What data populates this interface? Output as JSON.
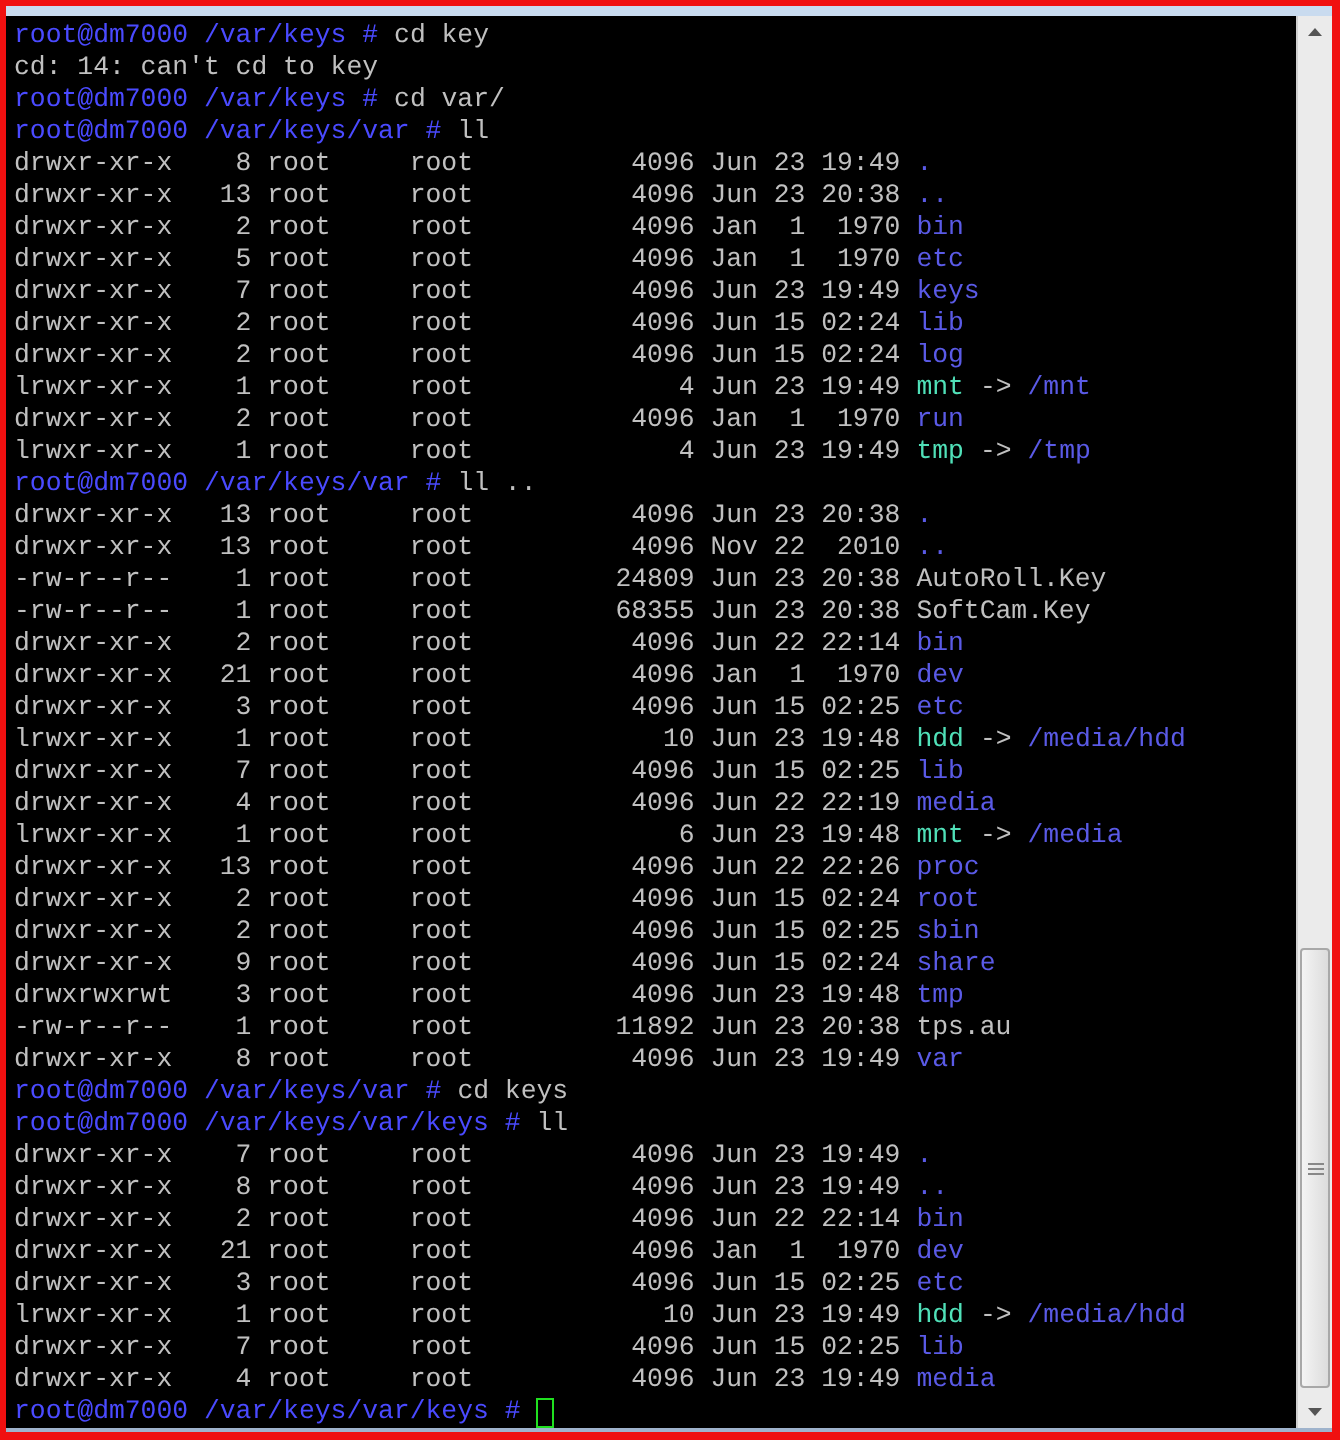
{
  "terminal": {
    "lines": [
      {
        "kind": "prompt",
        "prompt": "root@dm7000 /var/keys #",
        "command": "cd key"
      },
      {
        "kind": "output",
        "text": "cd: 14: can't cd to key"
      },
      {
        "kind": "prompt",
        "prompt": "root@dm7000 /var/keys #",
        "command": "cd var/"
      },
      {
        "kind": "prompt",
        "prompt": "root@dm7000 /var/keys/var #",
        "command": "ll"
      },
      {
        "kind": "entry",
        "details": "drwxr-xr-x    8 root     root          4096 Jun 23 19:49",
        "name": ".",
        "color": "#5a5ae6"
      },
      {
        "kind": "entry",
        "details": "drwxr-xr-x   13 root     root          4096 Jun 23 20:38",
        "name": "..",
        "color": "#5a5ae6"
      },
      {
        "kind": "entry",
        "details": "drwxr-xr-x    2 root     root          4096 Jan  1  1970",
        "name": "bin",
        "color": "#5a5ae6"
      },
      {
        "kind": "entry",
        "details": "drwxr-xr-x    5 root     root          4096 Jan  1  1970",
        "name": "etc",
        "color": "#5a5ae6"
      },
      {
        "kind": "entry",
        "details": "drwxr-xr-x    7 root     root          4096 Jun 23 19:49",
        "name": "keys",
        "color": "#5a5ae6"
      },
      {
        "kind": "entry",
        "details": "drwxr-xr-x    2 root     root          4096 Jun 15 02:24",
        "name": "lib",
        "color": "#5a5ae6"
      },
      {
        "kind": "entry",
        "details": "drwxr-xr-x    2 root     root          4096 Jun 15 02:24",
        "name": "log",
        "color": "#5a5ae6"
      },
      {
        "kind": "entry",
        "details": "lrwxr-xr-x    1 root     root             4 Jun 23 19:49",
        "name": "mnt",
        "color": "#50e0b8",
        "arrow": "->",
        "target": "/mnt"
      },
      {
        "kind": "entry",
        "details": "drwxr-xr-x    2 root     root          4096 Jan  1  1970",
        "name": "run",
        "color": "#5a5ae6"
      },
      {
        "kind": "entry",
        "details": "lrwxr-xr-x    1 root     root             4 Jun 23 19:49",
        "name": "tmp",
        "color": "#50e0b8",
        "arrow": "->",
        "target": "/tmp"
      },
      {
        "kind": "prompt",
        "prompt": "root@dm7000 /var/keys/var #",
        "command": "ll .."
      },
      {
        "kind": "entry",
        "details": "drwxr-xr-x   13 root     root          4096 Jun 23 20:38",
        "name": ".",
        "color": "#5a5ae6"
      },
      {
        "kind": "entry",
        "details": "drwxr-xr-x   13 root     root          4096 Nov 22  2010",
        "name": "..",
        "color": "#5a5ae6"
      },
      {
        "kind": "entry",
        "details": "-rw-r--r--    1 root     root         24809 Jun 23 20:38",
        "name": "AutoRoll.Key",
        "color": "#c0c0c0"
      },
      {
        "kind": "entry",
        "details": "-rw-r--r--    1 root     root         68355 Jun 23 20:38",
        "name": "SoftCam.Key",
        "color": "#c0c0c0"
      },
      {
        "kind": "entry",
        "details": "drwxr-xr-x    2 root     root          4096 Jun 22 22:14",
        "name": "bin",
        "color": "#5a5ae6"
      },
      {
        "kind": "entry",
        "details": "drwxr-xr-x   21 root     root          4096 Jan  1  1970",
        "name": "dev",
        "color": "#5a5ae6"
      },
      {
        "kind": "entry",
        "details": "drwxr-xr-x    3 root     root          4096 Jun 15 02:25",
        "name": "etc",
        "color": "#5a5ae6"
      },
      {
        "kind": "entry",
        "details": "lrwxr-xr-x    1 root     root            10 Jun 23 19:48",
        "name": "hdd",
        "color": "#50e0b8",
        "arrow": "->",
        "target": "/media/hdd"
      },
      {
        "kind": "entry",
        "details": "drwxr-xr-x    7 root     root          4096 Jun 15 02:25",
        "name": "lib",
        "color": "#5a5ae6"
      },
      {
        "kind": "entry",
        "details": "drwxr-xr-x    4 root     root          4096 Jun 22 22:19",
        "name": "media",
        "color": "#5a5ae6"
      },
      {
        "kind": "entry",
        "details": "lrwxr-xr-x    1 root     root             6 Jun 23 19:48",
        "name": "mnt",
        "color": "#50e0b8",
        "arrow": "->",
        "target": "/media"
      },
      {
        "kind": "entry",
        "details": "drwxr-xr-x   13 root     root          4096 Jun 22 22:26",
        "name": "proc",
        "color": "#5a5ae6"
      },
      {
        "kind": "entry",
        "details": "drwxr-xr-x    2 root     root          4096 Jun 15 02:24",
        "name": "root",
        "color": "#5a5ae6"
      },
      {
        "kind": "entry",
        "details": "drwxr-xr-x    2 root     root          4096 Jun 15 02:25",
        "name": "sbin",
        "color": "#5a5ae6"
      },
      {
        "kind": "entry",
        "details": "drwxr-xr-x    9 root     root          4096 Jun 15 02:24",
        "name": "share",
        "color": "#5a5ae6"
      },
      {
        "kind": "entry",
        "details": "drwxrwxrwt    3 root     root          4096 Jun 23 19:48",
        "name": "tmp",
        "color": "#5a5ae6"
      },
      {
        "kind": "entry",
        "details": "-rw-r--r--    1 root     root         11892 Jun 23 20:38",
        "name": "tps.au",
        "color": "#c0c0c0"
      },
      {
        "kind": "entry",
        "details": "drwxr-xr-x    8 root     root          4096 Jun 23 19:49",
        "name": "var",
        "color": "#5a5ae6"
      },
      {
        "kind": "prompt",
        "prompt": "root@dm7000 /var/keys/var #",
        "command": "cd keys"
      },
      {
        "kind": "prompt",
        "prompt": "root@dm7000 /var/keys/var/keys #",
        "command": "ll"
      },
      {
        "kind": "entry",
        "details": "drwxr-xr-x    7 root     root          4096 Jun 23 19:49",
        "name": ".",
        "color": "#5a5ae6"
      },
      {
        "kind": "entry",
        "details": "drwxr-xr-x    8 root     root          4096 Jun 23 19:49",
        "name": "..",
        "color": "#5a5ae6"
      },
      {
        "kind": "entry",
        "details": "drwxr-xr-x    2 root     root          4096 Jun 22 22:14",
        "name": "bin",
        "color": "#5a5ae6"
      },
      {
        "kind": "entry",
        "details": "drwxr-xr-x   21 root     root          4096 Jan  1  1970",
        "name": "dev",
        "color": "#5a5ae6"
      },
      {
        "kind": "entry",
        "details": "drwxr-xr-x    3 root     root          4096 Jun 15 02:25",
        "name": "etc",
        "color": "#5a5ae6"
      },
      {
        "kind": "entry",
        "details": "lrwxr-xr-x    1 root     root            10 Jun 23 19:49",
        "name": "hdd",
        "color": "#50e0b8",
        "arrow": "->",
        "target": "/media/hdd"
      },
      {
        "kind": "entry",
        "details": "drwxr-xr-x    7 root     root          4096 Jun 15 02:25",
        "name": "lib",
        "color": "#5a5ae6"
      },
      {
        "kind": "entry",
        "details": "drwxr-xr-x    4 root     root          4096 Jun 23 19:49",
        "name": "media",
        "color": "#5a5ae6"
      },
      {
        "kind": "prompt",
        "prompt": "root@dm7000 /var/keys/var/keys #",
        "cursor": true
      }
    ]
  }
}
